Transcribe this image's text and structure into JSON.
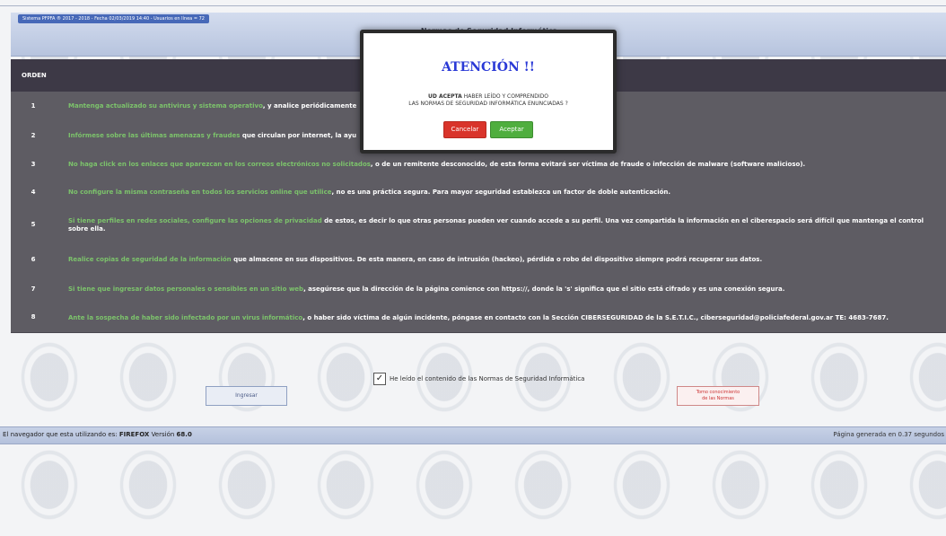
{
  "banner": {
    "system_info": "Sistema PFPFA ® 2017 - 2018 - Fecha 02/03/2019 14:40 - Usuarios en línea = 72",
    "title": "Normas de Seguridad Informática"
  },
  "table": {
    "header": "ORDEN",
    "rows": [
      {
        "num": "1",
        "highlight": "Mantenga actualizado su antivirus y sistema operativo",
        "text": ", y analice periódicamente"
      },
      {
        "num": "2",
        "highlight": "Infórmese sobre las últimas amenazas y fraudes",
        "text": " que circulan por internet, la ayu"
      },
      {
        "num": "3",
        "highlight": "No haga click en los enlaces que aparezcan en los correos electrónicos no solicitados",
        "text": ", o de un remitente desconocido, de esta forma evitará ser víctima de fraude o infección de malware (software malicioso)."
      },
      {
        "num": "4",
        "highlight": "No configure la misma contraseña en todos los servicios online que utilice",
        "text": ", no es una práctica segura. Para mayor seguridad establezca un factor de doble autenticación."
      },
      {
        "num": "5",
        "highlight": "Si tiene perfiles en redes sociales, configure las opciones de privacidad",
        "text": " de estos, es decir lo que otras personas pueden ver cuando accede a su perfil. Una vez compartida la información en el ciberespacio será difícil que mantenga el control sobre ella."
      },
      {
        "num": "6",
        "highlight": "Realice copias de seguridad de la información",
        "text": " que almacene en sus dispositivos. De esta manera, en caso de intrusión (hackeo), pérdida o robo del dispositivo siempre podrá recuperar sus datos."
      },
      {
        "num": "7",
        "highlight": "Si tiene que ingresar datos personales o sensibles en un sitio web",
        "text": ", asegúrese que la dirección de la página comience con https://, donde la 's' significa que el sitio está cifrado y es una conexión segura."
      },
      {
        "num": "8",
        "highlight": "Ante la sospecha de haber sido infectado por un virus informático",
        "text": ", o haber sido víctima de algún incidente, póngase en contacto con la Sección CIBERSEGURIDAD de la S.E.T.I.C., ciberseguridad@policiafederal.gov.ar  TE: 4683-7687."
      }
    ]
  },
  "accept": {
    "checked": true,
    "check_glyph": "✓",
    "label": "He leído el contenido de las Normas de Seguridad Informática"
  },
  "buttons": {
    "ingresar": "Ingresar",
    "normas_line1": "Tomo conocimiento",
    "normas_line2": "de las Normas"
  },
  "footer": {
    "browser_prefix": "El navegador que esta utilizando es:",
    "browser_name": "FIREFOX",
    "version_prefix": "Versión",
    "version": "68.0",
    "generated": "Página generada en 0.37 segundos"
  },
  "modal": {
    "title": "ATENCIÓN !!",
    "message_line1_bold": "UD ACEPTA",
    "message_line1": " HABER LEÍDO Y COMPRENDIDO",
    "message_line2": "LAS NORMAS DE SEGURIDAD INFORMÁTICA ENUNCIADAS ?",
    "cancel": "Cancelar",
    "accept": "Aceptar"
  },
  "colors": {
    "row_bg": "#5e5c63",
    "highlight_text": "#7cc36b",
    "modal_title": "#2a39d6",
    "cancel_btn": "#d9342b",
    "accept_btn": "#4fae3e"
  }
}
